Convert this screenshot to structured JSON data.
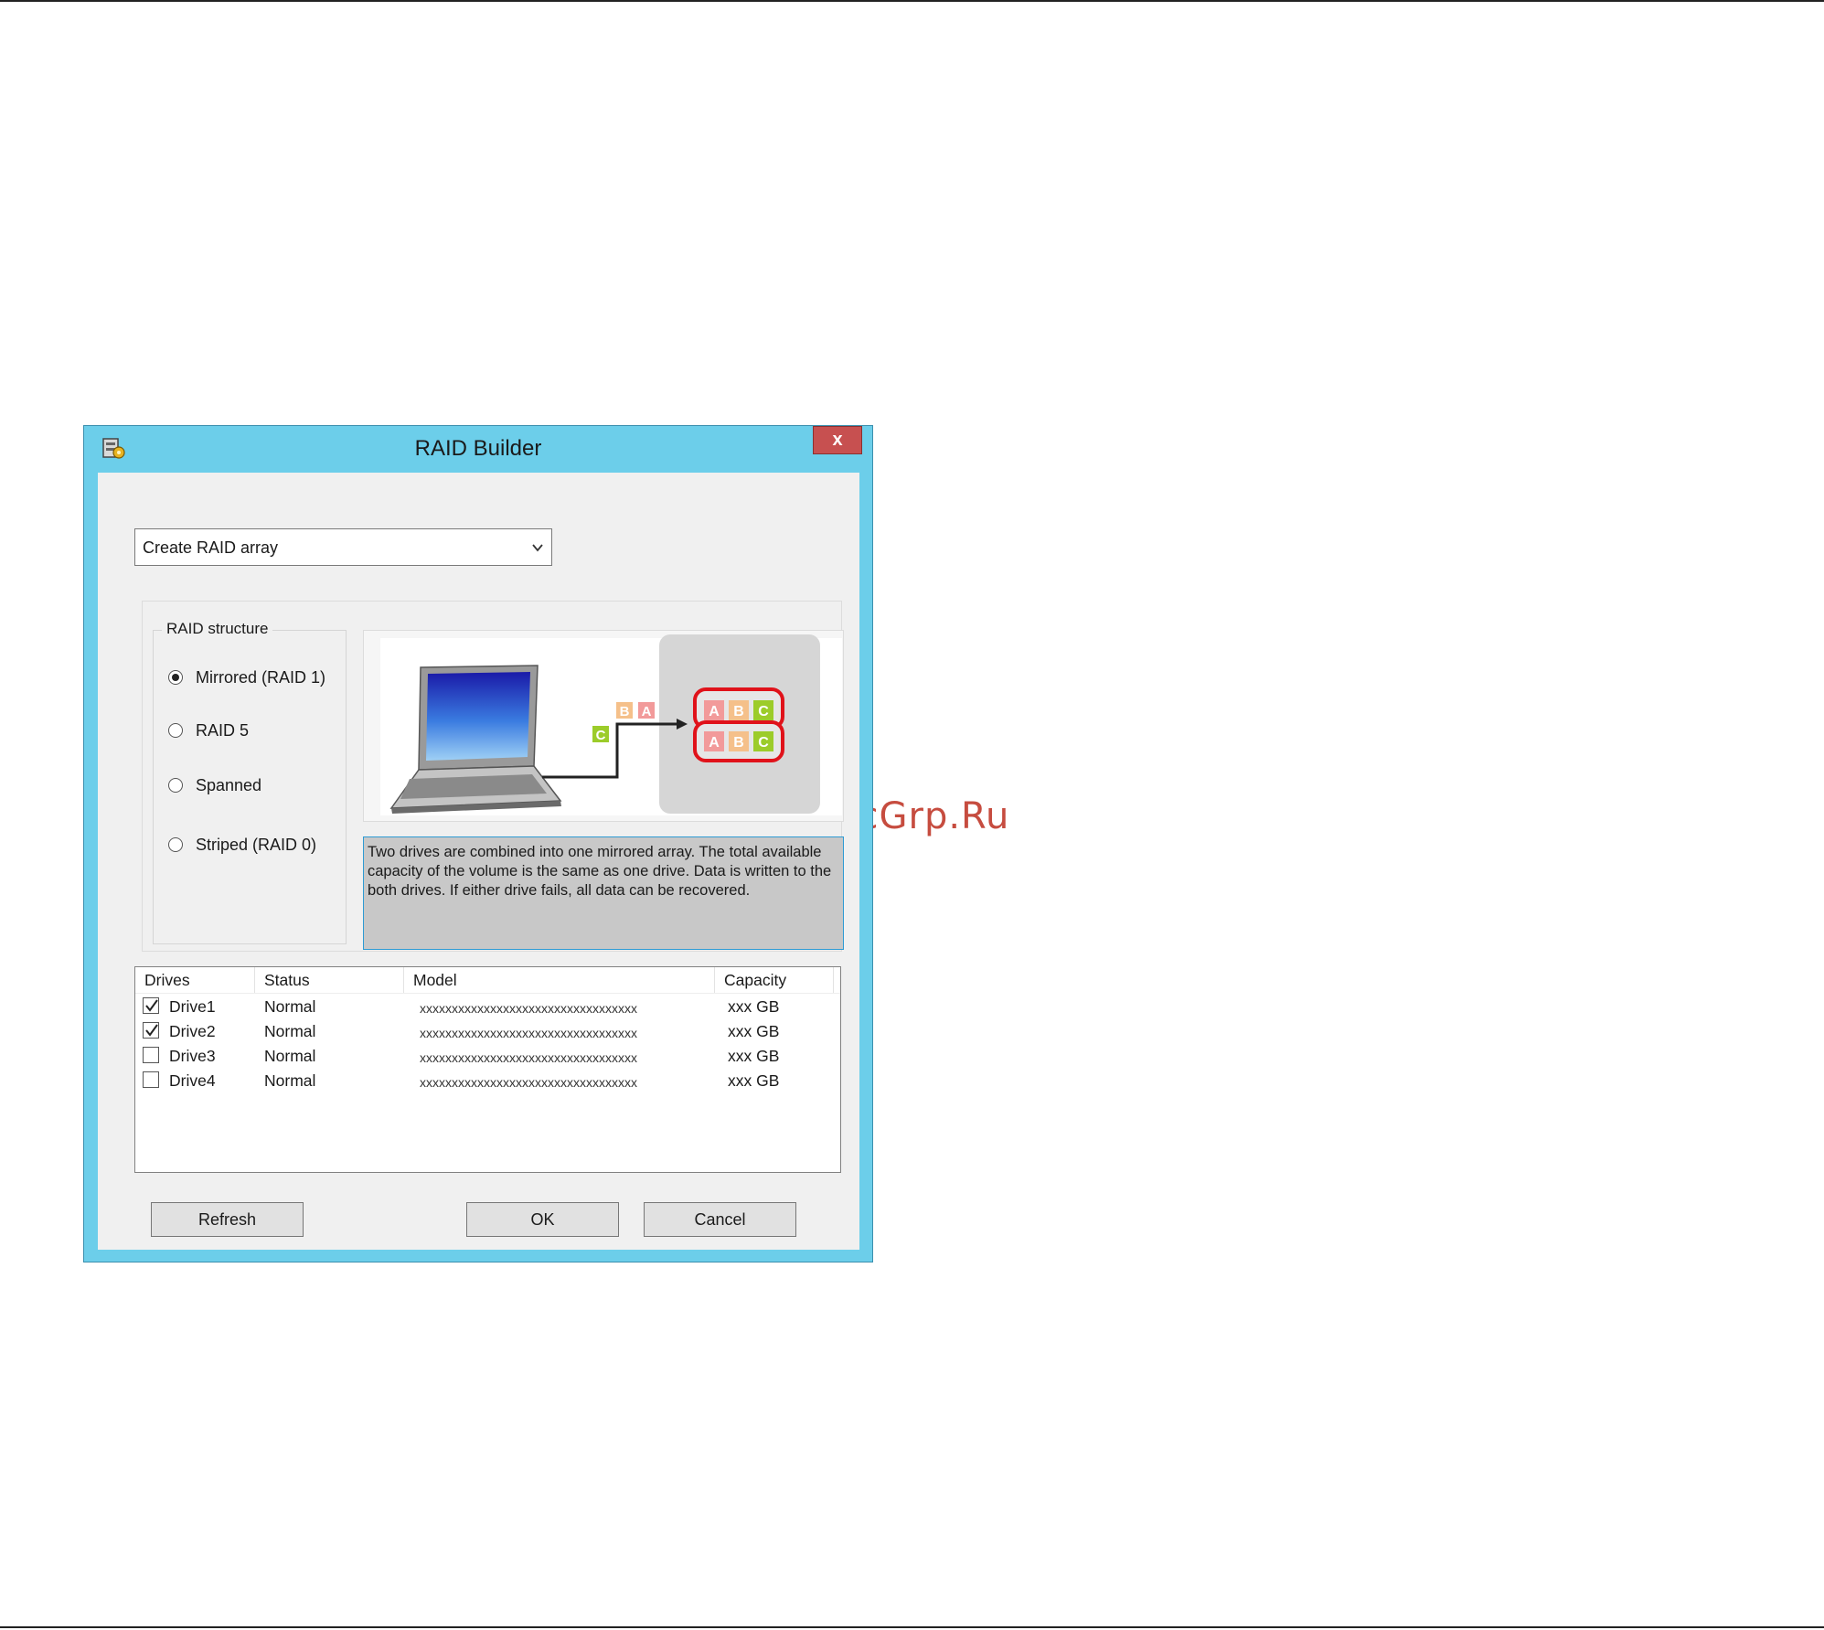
{
  "watermark": "McGrp.Ru",
  "window": {
    "title": "RAID Builder",
    "close_label": "x"
  },
  "mode_select": {
    "value": "Create RAID array"
  },
  "raid_structure": {
    "legend": "RAID structure",
    "options": [
      {
        "label": "Mirrored (RAID 1)",
        "selected": true
      },
      {
        "label": "RAID 5",
        "selected": false
      },
      {
        "label": "Spanned",
        "selected": false
      },
      {
        "label": "Striped (RAID 0)",
        "selected": false
      }
    ],
    "description": "Two drives are combined into one mirrored array. The total available capacity of the volume is the same as one drive. Data is written to the both drives. If either drive fails, all data can be recovered."
  },
  "illustration": {
    "blocks_in_transit": [
      "B",
      "A",
      "C"
    ],
    "disk_blocks": [
      "A",
      "B",
      "C"
    ],
    "colors": {
      "A": "#f29a9a",
      "B": "#f5c08a",
      "C": "#9ccc2a",
      "disk_outline": "#e0121a"
    }
  },
  "drive_list": {
    "columns": [
      "Drives",
      "Status",
      "Model",
      "Capacity"
    ],
    "rows": [
      {
        "name": "Drive1",
        "status": "Normal",
        "model": "xxxxxxxxxxxxxxxxxxxxxxxxxxxxxxxxxx",
        "capacity": "xxx GB",
        "checked": true
      },
      {
        "name": "Drive2",
        "status": "Normal",
        "model": "xxxxxxxxxxxxxxxxxxxxxxxxxxxxxxxxxx",
        "capacity": "xxx GB",
        "checked": true
      },
      {
        "name": "Drive3",
        "status": "Normal",
        "model": "xxxxxxxxxxxxxxxxxxxxxxxxxxxxxxxxxx",
        "capacity": "xxx GB",
        "checked": false
      },
      {
        "name": "Drive4",
        "status": "Normal",
        "model": "xxxxxxxxxxxxxxxxxxxxxxxxxxxxxxxxxx",
        "capacity": "xxx GB",
        "checked": false
      }
    ]
  },
  "buttons": {
    "refresh": "Refresh",
    "ok": "OK",
    "cancel": "Cancel"
  }
}
